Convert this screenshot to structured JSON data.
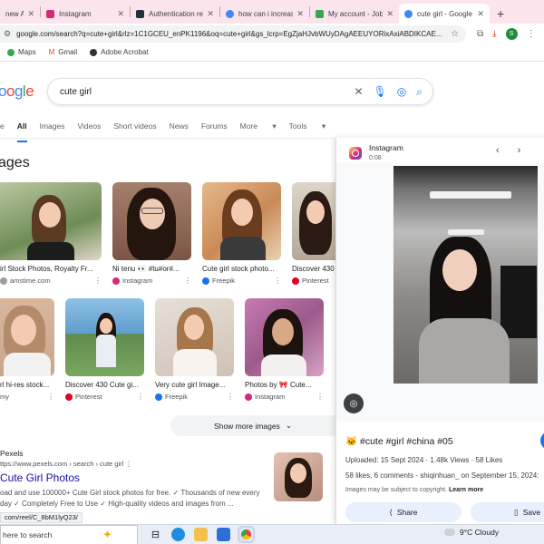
{
  "browser": {
    "tabs": [
      {
        "title": "new Ai",
        "favicon_color": "#ffffff",
        "active": false
      },
      {
        "title": "Instagram",
        "favicon_color": "#d62976",
        "active": false
      },
      {
        "title": "Authentication req",
        "favicon_color": "#232f3e",
        "active": false
      },
      {
        "title": "how can i increase",
        "favicon_color": "#4285f4",
        "active": false
      },
      {
        "title": "My account - Jobb",
        "favicon_color": "#34a853",
        "active": false
      },
      {
        "title": "cute girl - Google",
        "favicon_color": "#4285f4",
        "active": true
      }
    ],
    "new_tab_glyph": "+",
    "url": "google.com/search?q=cute+girl&rlz=1C1GCEU_enPK1196&oq=cute+girl&gs_lcrp=EgZjaHJvbWUyDAgAEEUYORixAxiABDIKCAE...",
    "profile_initial": "S",
    "bookmarks": [
      {
        "label": "Maps",
        "color": "#34a853"
      },
      {
        "label": "Gmail",
        "color": "#ea4335"
      },
      {
        "label": "Adobe Acrobat",
        "color": "#333333"
      }
    ]
  },
  "search": {
    "logo_text": "oogle",
    "query": "cute girl",
    "filters": [
      "e",
      "All",
      "Images",
      "Videos",
      "Short videos",
      "News",
      "Forums",
      "More",
      "Tools"
    ],
    "active_filter": "All",
    "section_title": "ages",
    "show_more": "Show more images"
  },
  "images_row1": [
    {
      "caption": "irl Stock Photos, Royalty Fr...",
      "source": "amstime.com",
      "src_color": "#9e9e9e"
    },
    {
      "caption": "Ni tenu 👀 #tu#or#...",
      "source": "Instagram",
      "src_color": "#d62976"
    },
    {
      "caption": "Cute girl stock photo...",
      "source": "Freepik",
      "src_color": "#1a73e8"
    },
    {
      "caption": "Discover 430",
      "source": "Pinterest",
      "src_color": "#e60023"
    }
  ],
  "images_row2": [
    {
      "caption": "rl hi-res stock...",
      "source": "my",
      "src_color": "#9e9e9e"
    },
    {
      "caption": "Discover 430 Cute gi...",
      "source": "Pinterest",
      "src_color": "#e60023"
    },
    {
      "caption": "Very cute girl Image...",
      "source": "Freepik",
      "src_color": "#1a73e8"
    },
    {
      "caption": "Photos by 🎀 Cute...",
      "source": "Instagram",
      "src_color": "#d62976"
    }
  ],
  "result": {
    "site": "Pexels",
    "url": "ttps://www.pexels.com › search › cute girl",
    "title": "Cute Girl Photos",
    "snippet": "oad and use 100000+ Cute Girl stock photos for free. ✓ Thousands of new every day ✓ Completely Free to Use ✓ High-quality videos and images from ...",
    "status_url": "com/reel/C_8bM1lyQ23/"
  },
  "panel": {
    "source": "Instagram",
    "duration": "0:08",
    "title": "🐱 #cute #girl #china #05",
    "meta": "Uploaded: 15 Sept 2024 · 1.48k Views · 58 Likes",
    "desc": "58 likes, 6 comments - shiqinhuan_ on September 15, 2024:",
    "copyright": "Images may be subject to copyright.",
    "learn_more": "Learn more",
    "share": "Share",
    "save": "Save"
  },
  "taskbar": {
    "search_placeholder": "here to search",
    "weather": "9°C  Cloudy"
  }
}
